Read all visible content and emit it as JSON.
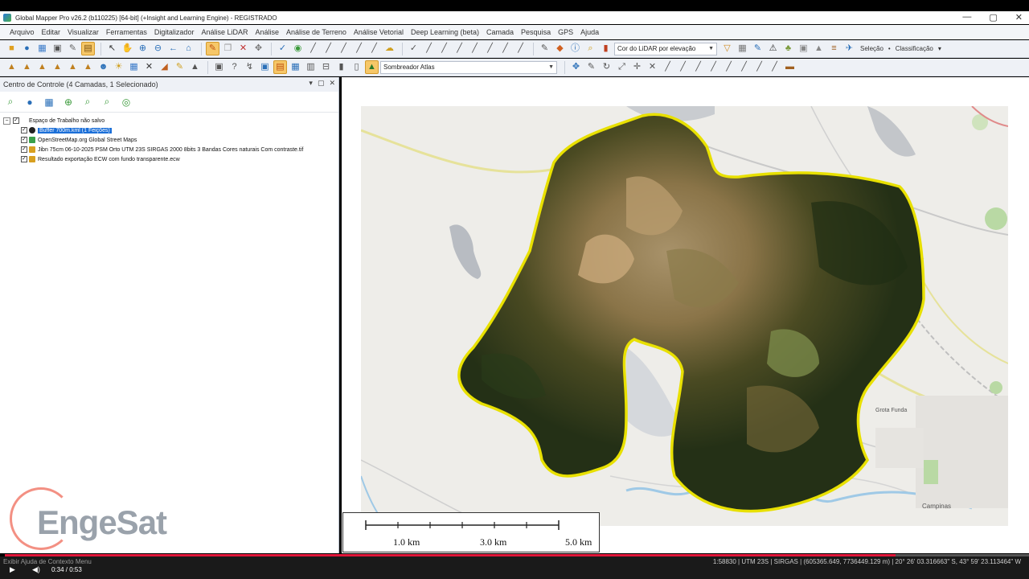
{
  "window": {
    "title": "Global Mapper Pro v26.2 (b110225) [64-bit] (+Insight and Learning Engine) - REGISTRADO",
    "controls": [
      "—",
      "▢",
      "✕"
    ]
  },
  "menu": [
    "Arquivo",
    "Editar",
    "Visualizar",
    "Ferramentas",
    "Digitalizador",
    "Análise LiDAR",
    "Análise",
    "Análise de Terreno",
    "Análise Vetorial",
    "Deep Learning (beta)",
    "Camada",
    "Pesquisa",
    "GPS",
    "Ajuda"
  ],
  "toolbar": {
    "lidar_color_combo": "Cor do LiDAR por elevação",
    "selection_label": "Seleção",
    "classification_label": "Classificação",
    "shader_combo": "Sombreador Atlas"
  },
  "control_center": {
    "title": "Centro de Controle (4 Camadas, 1 Selecionado)",
    "workspace": "Espaço de Trabalho não salvo",
    "layers": [
      {
        "name": "Buffer 700m.kml (1 Feições)",
        "selected": true,
        "icon_color": "#1b6fd8"
      },
      {
        "name": "OpenStreetMap.org Global Street Maps",
        "selected": false,
        "icon_color": "#3aa04a"
      },
      {
        "name": "Jibn 75cm 06-10-2025 PSM Orto UTM 23S SIRGAS 2000 8bits 3 Bandas Cores naturais Com contraste.tif",
        "selected": false,
        "icon_color": "#d8a020"
      },
      {
        "name": "Resultado exportação ECW com fundo transparente.ecw",
        "selected": false,
        "icon_color": "#d8a020"
      }
    ]
  },
  "watermark": {
    "brand": "EngeSat"
  },
  "scalebar": {
    "labels": [
      "1.0 km",
      "3.0 km",
      "5.0 km"
    ]
  },
  "map_labels": [
    "Campinas",
    "Grota Funda"
  ],
  "status": {
    "left": "Exibir Ajuda de Contexto Menu",
    "right": "1:58830 | UTM 23S | SIRGAS | (605365.649, 7736449.129 m) | 20° 26' 03.316663\" S, 43° 59' 23.113464\" W",
    "time": "0:34 / 0:53",
    "progress_percent": 87
  },
  "colors": {
    "buffer_outline": "#e8e000",
    "selection_highlight": "#1b6fd8",
    "progress": "#e0163a"
  }
}
